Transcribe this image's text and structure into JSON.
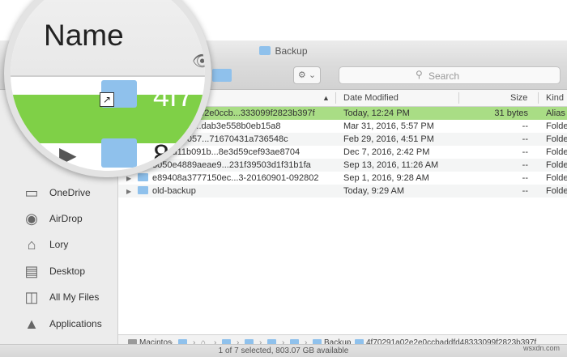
{
  "window": {
    "title": "Backup"
  },
  "toolbar": {
    "eye_icon": "eye-icon",
    "action_icon": "gear-icon",
    "search": {
      "placeholder": "Search"
    }
  },
  "columns": {
    "date": "Date Modified",
    "size": "Size",
    "kind": "Kind",
    "sort_glyph": "▲"
  },
  "rows": [
    {
      "name": "4f70291a02e2e0ccb...333099f2823b397f",
      "date": "Today, 12:24 PM",
      "size": "31 bytes",
      "kind": "Alias"
    },
    {
      "name": "99951fecd...dab3e558b0eb15a8",
      "date": "Mar 31, 2016, 5:57 PM",
      "size": "--",
      "kind": "Folde"
    },
    {
      "name": "6e37357057...71670431a736548c",
      "date": "Feb 29, 2016, 4:51 PM",
      "size": "--",
      "kind": "Folde"
    },
    {
      "name": "2653d11b091b...8e3d59cef93ae8704",
      "date": "Dec 7, 2016, 2:42 PM",
      "size": "--",
      "kind": "Folde"
    },
    {
      "name": "3050e4889aeae9...231f39503d1f31b1fa",
      "date": "Sep 13, 2016, 11:26 AM",
      "size": "--",
      "kind": "Folde"
    },
    {
      "name": "e89408a3777150ec...3-20160901-092802",
      "date": "Sep 1, 2016, 9:28 AM",
      "size": "--",
      "kind": "Folde"
    },
    {
      "name": "old-backup",
      "date": "Today, 9:29 AM",
      "size": "--",
      "kind": "Folde"
    }
  ],
  "sidebar": {
    "items": [
      {
        "label": "OneDrive",
        "icon": "folder-icon"
      },
      {
        "label": "AirDrop",
        "icon": "airdrop-icon"
      },
      {
        "label": "Lory",
        "icon": "home-icon"
      },
      {
        "label": "Desktop",
        "icon": "desktop-icon"
      },
      {
        "label": "All My Files",
        "icon": "all-files-icon"
      },
      {
        "label": "Applications",
        "icon": "applications-icon"
      }
    ]
  },
  "pathbar": {
    "start": "Macintos",
    "backup": "Backup",
    "last": "4f70291a02e2e0ccbaddfd48333099f2823b397f"
  },
  "status": "1 of 7 selected, 803.07 GB available",
  "magnifier": {
    "header": "Name",
    "row1_text": "4f7",
    "row2_text": "8"
  },
  "watermark": "wsxdn.com",
  "colors": {
    "selection": "#a9dd85",
    "folder": "#8fc1ec",
    "magnifier_selection": "#7fd047"
  }
}
